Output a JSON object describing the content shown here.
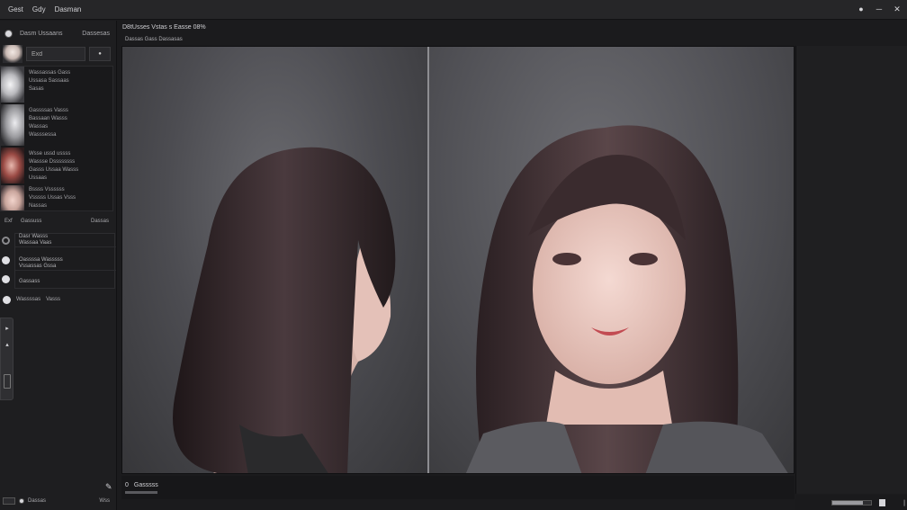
{
  "menu": {
    "items": [
      "Gest",
      "Gdy",
      "Dasman"
    ]
  },
  "window_controls": {
    "chat": "●",
    "minimize": "─",
    "close": "✕"
  },
  "sidebar": {
    "header_title": "Dasm Ussaans",
    "header_action": "Dassesas",
    "search": {
      "value": "Exd",
      "button": "●"
    },
    "assets": [
      {
        "lines": [
          "Wassassas Gass",
          "Ussasa Sassaas",
          "Sasas"
        ]
      },
      {
        "lines": [
          "Gassssas Vasss",
          "Bassaan Wasss",
          "Wassas",
          "Wasssessa"
        ]
      },
      {
        "lines": [
          "Wsse ussd ussss",
          "Wassse Dssssssss",
          "Gasss Ussaa Wasss",
          "Ussaas"
        ]
      },
      {
        "lines": [
          "Bssss Vssssss",
          "Vsssss Ussas Vsss",
          "Nassas"
        ]
      }
    ],
    "layers_header": {
      "first": "Exf",
      "second": "Gassuss",
      "third": "Dassas"
    },
    "layers": [
      {
        "title": "Dasr Wasss",
        "sub": "Wassaa Vaas"
      },
      {
        "title": "Oassssa Wasssss",
        "sub": "Vssassas Gssa"
      },
      {
        "title": "Gassass",
        "sub": ""
      }
    ],
    "misc_row": {
      "label": "Wassssas",
      "value": "Vasss"
    },
    "footer": {
      "label": "Dassas",
      "end": "Wss"
    }
  },
  "tools": [
    "▸",
    "▴",
    "▯"
  ],
  "document": {
    "tab_title": "D8tUsses Vstas  s  Easse 08%",
    "subtitle": "Dassas  Gass Dassasas"
  },
  "status_bar": {
    "page": "0",
    "label": "Gasssss"
  },
  "colors": {
    "bg": "#1b1b1d",
    "panel": "#1e1e20",
    "canvas": "#2a2a2d",
    "hair": "#2e2427",
    "skin": "#e8c5bc"
  },
  "zoom": {
    "value": 0.8
  },
  "icons": {
    "pen": "✎",
    "right_end": "❘"
  }
}
